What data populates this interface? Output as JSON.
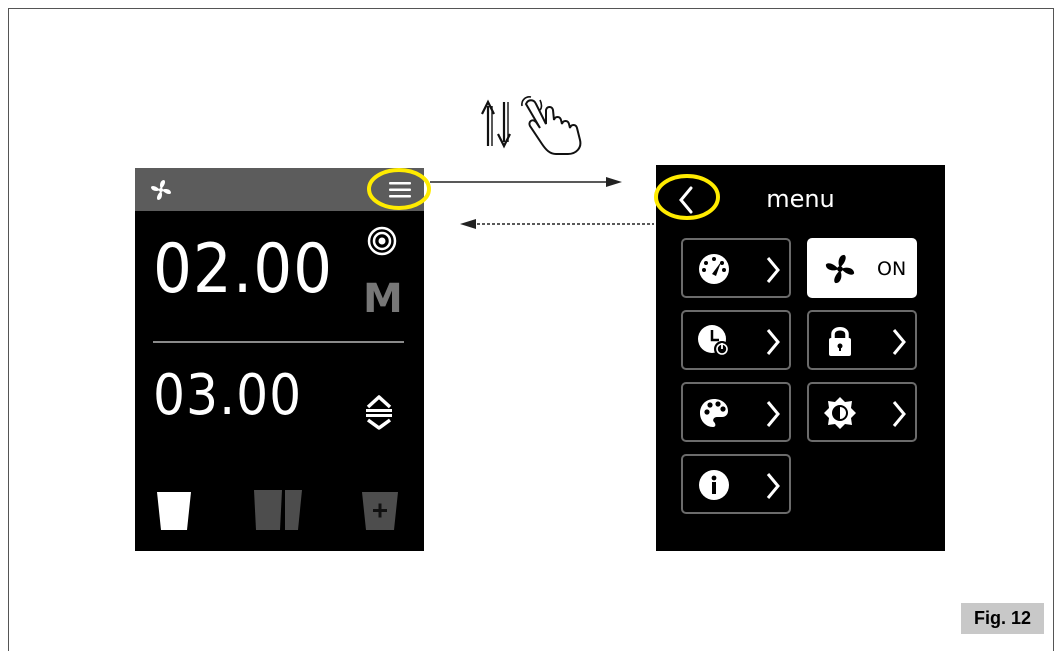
{
  "main_screen": {
    "value_top": "02.00",
    "value_bottom": "03.00",
    "mode_letter": "M",
    "icons": [
      "fan-icon",
      "menu-icon",
      "target-icon",
      "up-down-arrows-icon",
      "cup-icon",
      "double-cup-icon",
      "cup-plus-icon"
    ]
  },
  "menu_screen": {
    "title": "menu",
    "fan_status": "ON",
    "tiles": [
      "gauge-icon",
      "fan-icon",
      "timer-icon",
      "lock-icon",
      "palette-icon",
      "brightness-icon",
      "info-icon"
    ]
  },
  "gesture": {
    "icons": [
      "swipe-up-down-arrows-icon",
      "hand-pointer-icon"
    ]
  },
  "figure_label": "Fig. 12",
  "colors": {
    "highlight": "#ffeb00",
    "screen_bg": "#000000",
    "topbar_bg": "#5c5c5c",
    "tile_border": "#6b6b6b",
    "tag_bg": "#c8c8c8"
  }
}
